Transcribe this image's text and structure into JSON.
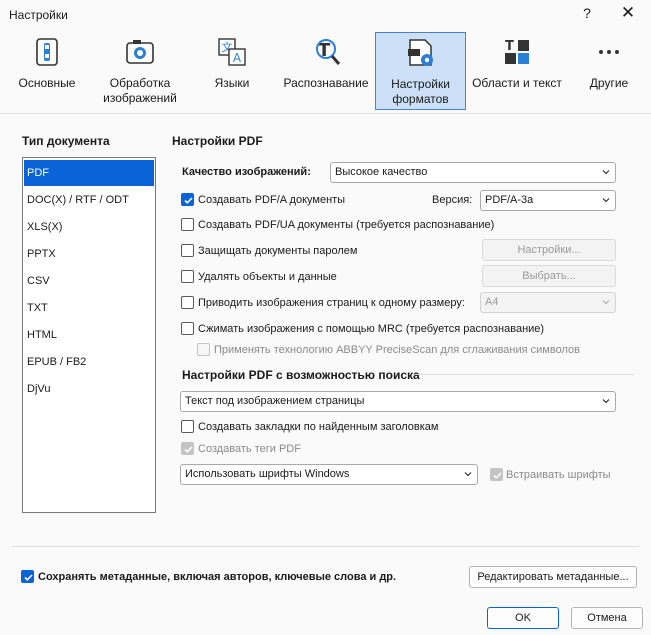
{
  "window": {
    "title": "Настройки",
    "help": "?",
    "close": "✕"
  },
  "toolbar": {
    "items": [
      {
        "label": "Основные",
        "icon": "general-settings-icon"
      },
      {
        "label": "Обработка изображений",
        "icon": "camera-icon"
      },
      {
        "label": "Языки",
        "icon": "translate-icon"
      },
      {
        "label": "Распознавание",
        "icon": "recognition-icon"
      },
      {
        "label": "Настройки форматов",
        "icon": "format-settings-icon",
        "active": true
      },
      {
        "label": "Области и текст",
        "icon": "areas-text-icon"
      },
      {
        "label": "Другие",
        "icon": "more-icon"
      }
    ]
  },
  "left": {
    "heading": "Тип документа",
    "items": [
      "PDF",
      "DOC(X) / RTF / ODT",
      "XLS(X)",
      "PPTX",
      "CSV",
      "TXT",
      "HTML",
      "EPUB / FB2",
      "DjVu"
    ],
    "selected": "PDF"
  },
  "pdf": {
    "heading": "Настройки PDF",
    "quality_label": "Качество изображений:",
    "quality_value": "Высокое качество",
    "pdfa_label": "Создавать PDF/A документы",
    "version_label": "Версия:",
    "version_value": "PDF/A-3a",
    "pdfua_label": "Создавать PDF/UA документы (требуется распознавание)",
    "password_label": "Защищать документы паролем",
    "password_button": "Настройки...",
    "remove_label": "Удалять объекты и данные",
    "remove_button": "Выбрать...",
    "resize_label": "Приводить изображения страниц к одному размеру:",
    "resize_value": "A4",
    "mrc_label": "Сжимать изображения с помощью MRC (требуется распознавание)",
    "precisescan_label": "Применять технологию ABBYY PreciseScan для сглаживания символов"
  },
  "searchable": {
    "heading": "Настройки PDF с возможностью поиска",
    "mode_value": "Текст под изображением страницы",
    "bookmarks_label": "Создавать закладки по найденным заголовкам",
    "tags_label": "Создавать теги PDF",
    "fonts_value": "Использовать шрифты Windows",
    "embed_label": "Встраивать шрифты"
  },
  "footer": {
    "metadata_label": "Сохранять метаданные, включая авторов, ключевые слова и др.",
    "edit_metadata_button": "Редактировать метаданные...",
    "ok": "OK",
    "cancel": "Отмена"
  },
  "colors": {
    "accent": "#0a64d8",
    "active_tab": "#cce0f7"
  }
}
